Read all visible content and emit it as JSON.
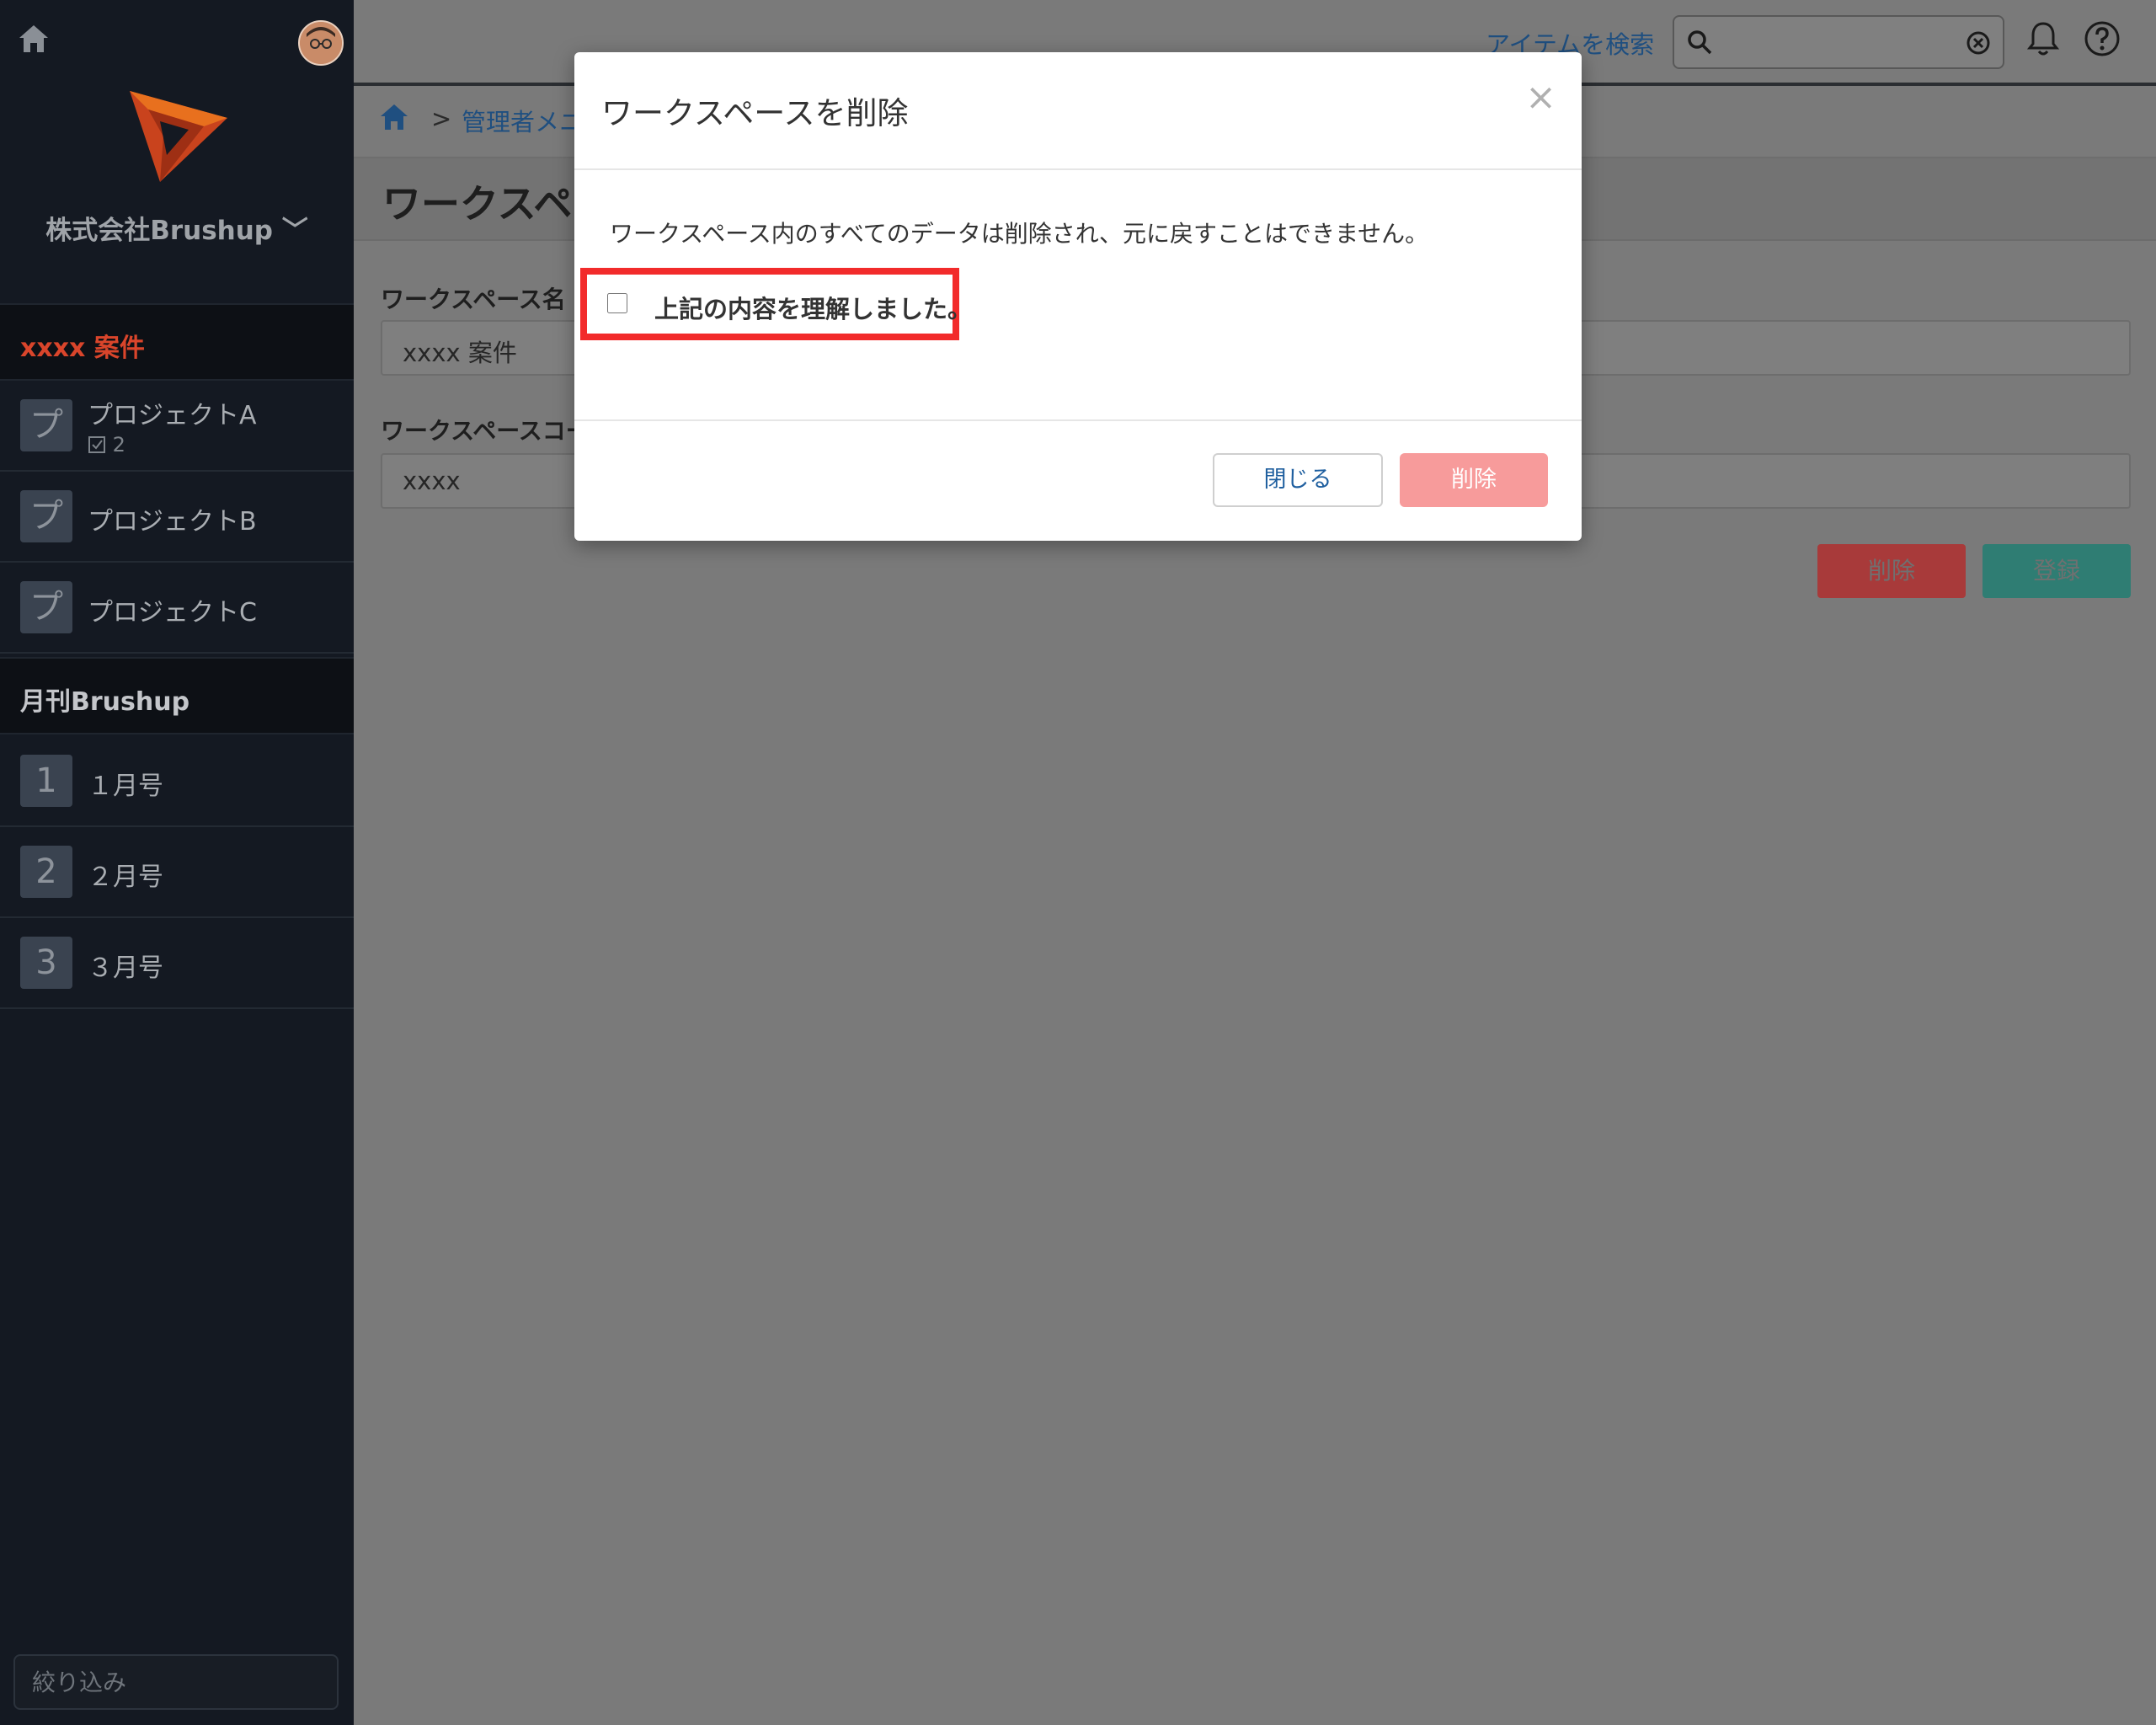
{
  "sidebar": {
    "company_name": "株式会社Brushup ﹀",
    "sections": [
      {
        "title": "xxxx 案件",
        "title_color": "#d9452b",
        "items": [
          {
            "tile": "プ",
            "label": "プロジェクトA",
            "meta": "2"
          },
          {
            "tile": "プ",
            "label": "プロジェクトB"
          },
          {
            "tile": "プ",
            "label": "プロジェクトC"
          }
        ]
      },
      {
        "title": "月刊Brushup",
        "title_color": "#c4c6ca",
        "items": [
          {
            "tile": "1",
            "label": "１月号"
          },
          {
            "tile": "2",
            "label": "２月号"
          },
          {
            "tile": "3",
            "label": "３月号"
          }
        ]
      }
    ],
    "filter_placeholder": "絞り込み"
  },
  "header": {
    "search_link": "アイテムを検索"
  },
  "breadcrumb": {
    "separator": ">",
    "item": "管理者メニ"
  },
  "page": {
    "title": "ワークスペ",
    "fields": [
      {
        "label": "ワークスペース名",
        "value": "xxxx 案件"
      },
      {
        "label": "ワークスペースコー",
        "value": "xxxx"
      }
    ],
    "delete_label": "削除",
    "register_label": "登録"
  },
  "modal": {
    "title": "ワークスペースを削除",
    "close_icon": "×",
    "message": "ワークスペース内のすべてのデータは削除され、元に戻すことはできません。",
    "confirm_label": "上記の内容を理解しました。",
    "close_button": "閉じる",
    "delete_button": "削除"
  },
  "colors": {
    "sidebar_bg": "#141922",
    "overlay": "#7a7a7a",
    "highlight": "#f22b2b",
    "delete_button": "#f79b9b",
    "bg_delete": "#a83a3a",
    "bg_register": "#2f7d73"
  }
}
